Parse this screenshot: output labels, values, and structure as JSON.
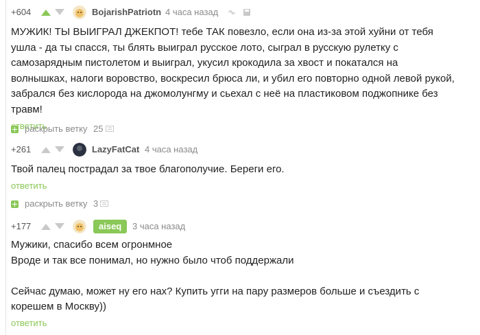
{
  "colors": {
    "accent": "#8ac858",
    "meta": "#8a8a8a",
    "text": "#222222"
  },
  "comments": [
    {
      "rating": "+604",
      "author": "BojarishPatriotn",
      "time": "4 часа назад",
      "text": "МУЖИК! ТЫ ВЫИГРАЛ ДЖЕКПОТ! тебе ТАК повезло, если она из-за этой хуйни от тебя ушла - да ты спасся, ты блять выиграл русское лото, сыграл в русскую рулетку с самозарядным пистолетом и выиграл, укусил крокодила за хвост и покатался на волнышках, налоги воровство, воскресил брюса ли, и убил его повторно одной левой рукой, забрался без кислорода на джомолунгму и сьехал с неё на пластиковом поджопнике без травм!",
      "reply": "ответить",
      "icons": [
        "arrow-up-icon",
        "arrow-down-icon",
        "link-icon",
        "save-icon"
      ]
    },
    {
      "rating": "+261",
      "author": "LazyFatCat",
      "time": "4 часа назад",
      "text": "Твой палец пострадал за твое благополучие. Береги его.",
      "reply": "ответить"
    },
    {
      "rating": "+177",
      "author": "aiseq",
      "time": "3 часа назад",
      "text": "Мужики, спасибо всем огронмное\nВроде и так все понимал, но нужно было чтоб поддержали\n\nСейчас думаю, может ну его нах? Купить угги на пару размеров больше и съездить с корешем в Москву))",
      "reply": "ответить"
    }
  ],
  "expand1": {
    "label": "раскрыть ветку",
    "count": "25"
  },
  "expand2": {
    "label": "раскрыть ветку",
    "count": "3"
  }
}
